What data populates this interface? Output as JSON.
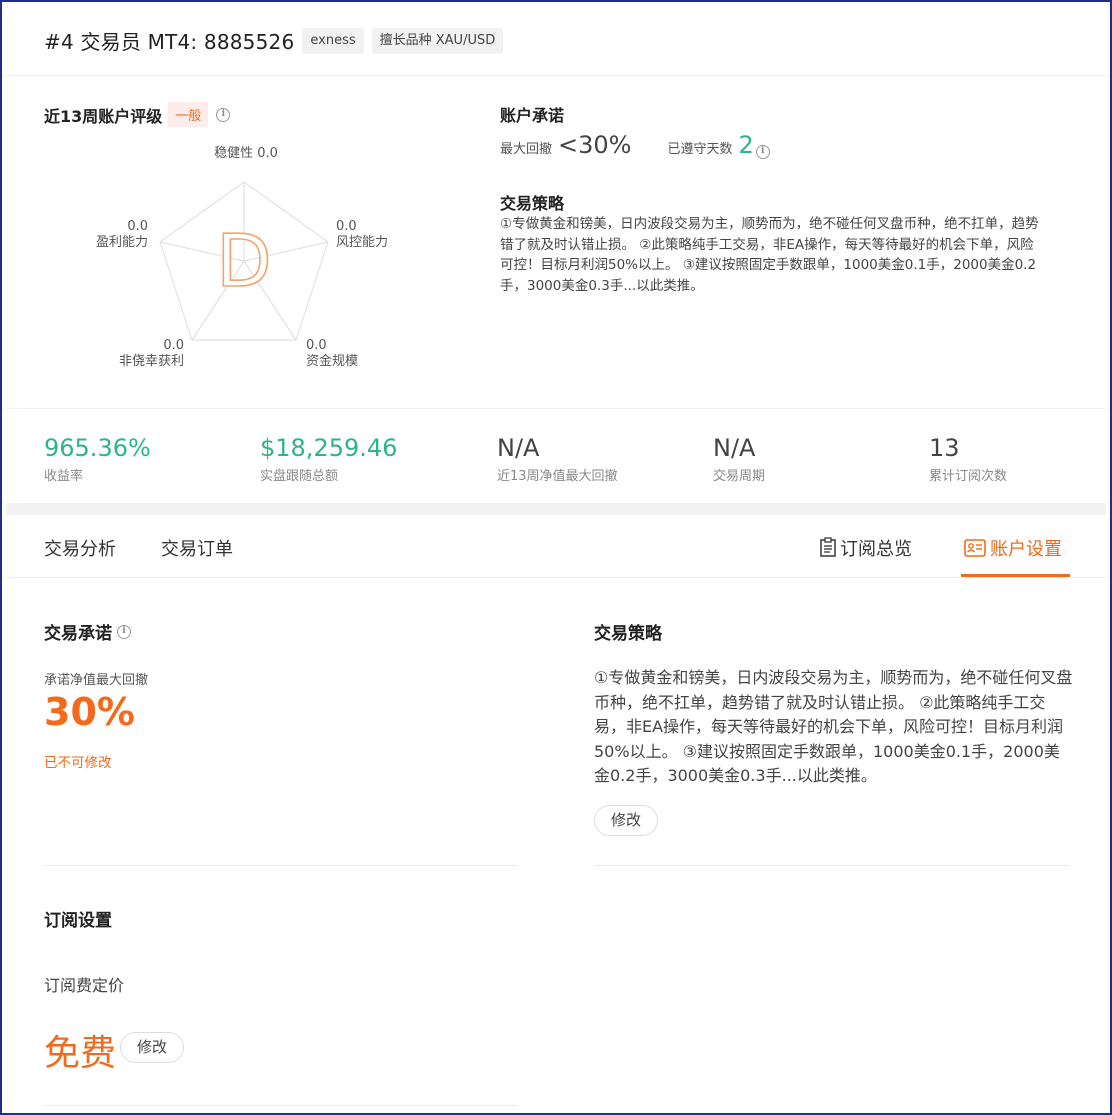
{
  "header": {
    "title": "#4 交易员 MT4: 8885526",
    "tags": [
      "exness",
      "擅长品种 XAU/USD"
    ]
  },
  "rating": {
    "title": "近13周账户评级",
    "level": "一般",
    "grade": "D",
    "dims": [
      {
        "name": "稳健性",
        "value": "0.0"
      },
      {
        "name": "风控能力",
        "value": "0.0"
      },
      {
        "name": "资金规模",
        "value": "0.0"
      },
      {
        "name": "非侥幸获利",
        "value": "0.0"
      },
      {
        "name": "盈利能力",
        "value": "0.0"
      }
    ]
  },
  "commitment": {
    "title": "账户承诺",
    "max_drawdown_label": "最大回撤",
    "max_drawdown_value": "<30%",
    "days_label": "已遵守天数",
    "days_value": "2"
  },
  "strategy": {
    "title": "交易策略",
    "text": "①专做黄金和镑美，日内波段交易为主，顺势而为，绝不碰任何叉盘币种，绝不扛单，趋势错了就及时认错止损。 ②此策略纯手工交易，非EA操作，每天等待最好的机会下单，风险可控！目标月利润50%以上。 ③建议按照固定手数跟单，1000美金0.1手，2000美金0.2手，3000美金0.3手...以此类推。"
  },
  "stats": [
    {
      "value": "965.36%",
      "label": "收益率"
    },
    {
      "value": "$18,259.46",
      "label": "实盘跟随总额"
    },
    {
      "value": "N/A",
      "label": "近13周净值最大回撤"
    },
    {
      "value": "N/A",
      "label": "交易周期"
    },
    {
      "value": "13",
      "label": "累计订阅次数"
    }
  ],
  "tabs": {
    "analysis": "交易分析",
    "orders": "交易订单",
    "overview": "订阅总览",
    "settings": "账户设置"
  },
  "trade_commit": {
    "title": "交易承诺",
    "label": "承诺净值最大回撤",
    "value": "30%",
    "note": "已不可修改"
  },
  "strategy2": {
    "title": "交易策略",
    "edit": "修改"
  },
  "subscription": {
    "title": "订阅设置",
    "fee_label": "订阅费定价",
    "fee_value": "免费",
    "edit": "修改"
  },
  "colors": {
    "accent": "#f26a1b",
    "green": "#2db48b",
    "frame": "#1f2f8c"
  }
}
